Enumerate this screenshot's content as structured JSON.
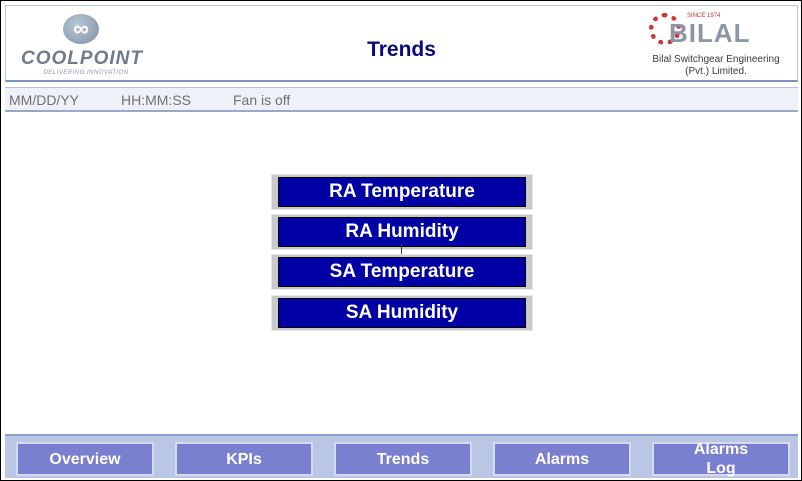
{
  "header": {
    "title": "Trends",
    "left_logo": {
      "brand": "COOLPOINT",
      "tagline": "DELIVERING INNOVATION"
    },
    "right_logo": {
      "brand": "BILAL",
      "since": "SINCE 1974",
      "line1": "Bilal Switchgear Engineering",
      "line2": "(Pvt.) Limited."
    }
  },
  "status": {
    "date": "MM/DD/YY",
    "time": "HH:MM:SS",
    "fan": "Fan is off"
  },
  "trends": [
    {
      "label": "RA Temperature"
    },
    {
      "label": "RA Humidity"
    },
    {
      "label": "SA Temperature"
    },
    {
      "label": "SA Humidity"
    }
  ],
  "nav": [
    {
      "label": "Overview"
    },
    {
      "label": "KPIs"
    },
    {
      "label": "Trends"
    },
    {
      "label": "Alarms"
    },
    {
      "label": "Alarms Log"
    }
  ],
  "colors": {
    "trend_button": "#0000a5",
    "nav_button": "#7b7fcf",
    "title": "#0a0a7a"
  }
}
